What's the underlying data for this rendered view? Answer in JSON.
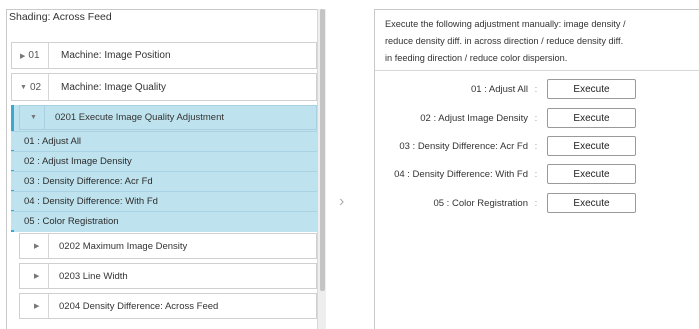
{
  "left_panel": {
    "title": "Shading: Across Feed",
    "rows": [
      {
        "num": "01",
        "label": "Machine: Image Position"
      },
      {
        "num": "02",
        "label": "Machine: Image Quality"
      }
    ],
    "sub_header": "0201 Execute Image Quality Adjustment",
    "sub_items": [
      "01 : Adjust All",
      "02 : Adjust Image Density",
      "03 : Density Difference: Acr Fd",
      "04 : Density Difference: With Fd",
      "05 : Color Registration"
    ],
    "child_rows": [
      "0202 Maximum Image Density",
      "0203 Line Width",
      "0204 Density Difference: Across Feed"
    ]
  },
  "right_panel": {
    "description_lines": [
      "Execute the following adjustment manually: image density /",
      "reduce density diff. in across direction / reduce density diff.",
      "in feeding direction / reduce color dispersion."
    ],
    "items": [
      {
        "label": "01 : Adjust All",
        "button": "Execute"
      },
      {
        "label": "02 : Adjust Image Density",
        "button": "Execute"
      },
      {
        "label": "03 : Density Difference: Acr Fd",
        "button": "Execute"
      },
      {
        "label": "04 : Density Difference: With Fd",
        "button": "Execute"
      },
      {
        "label": "05 : Color Registration",
        "button": "Execute"
      }
    ]
  }
}
